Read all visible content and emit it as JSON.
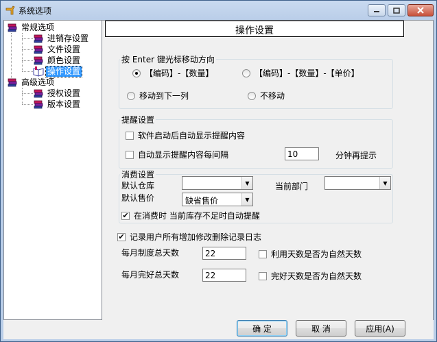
{
  "window": {
    "title": "系统选项"
  },
  "tree": {
    "groups": [
      {
        "label": "常规选项",
        "children": [
          "进销存设置",
          "文件设置",
          "颜色设置",
          "操作设置"
        ]
      },
      {
        "label": "高级选项",
        "children": [
          "授权设置",
          "版本设置"
        ]
      }
    ],
    "selected": "操作设置"
  },
  "panel": {
    "header": "操作设置",
    "enter_group": {
      "legend": "按 Enter 键光标移动方向",
      "options": [
        "【编码】-【数量】",
        "【编码】-【数量】-【单价】",
        "移动到下一列",
        "不移动"
      ],
      "selected_index": 0
    },
    "reminder_group": {
      "legend": "提醒设置",
      "show_on_start": "软件启动后自动显示提醒内容",
      "auto_show_interval": "自动显示提醒内容每间隔",
      "interval_value": "10",
      "interval_suffix": "分钟再提示"
    },
    "consume_group": {
      "legend": "消费设置",
      "default_warehouse_label": "默认仓库",
      "default_warehouse_value": "",
      "current_dept_label": "当前部门",
      "current_dept_value": "",
      "default_price_label": "默认售价",
      "default_price_value": "缺省售价",
      "stock_alert_label": "在消费时 当前库存不足时自动提醒",
      "stock_alert_checked": true
    },
    "log_changes": {
      "label": "记录用户所有增加修改删除记录日志",
      "checked": true
    },
    "monthly_days_label": "每月制度总天数",
    "monthly_days_value": "22",
    "use_natural_days_label": "利用天数是否为自然天数",
    "monthly_good_label": "每月完好总天数",
    "monthly_good_value": "22",
    "good_natural_days_label": "完好天数是否为自然天数"
  },
  "buttons": {
    "ok": "确 定",
    "cancel": "取 消",
    "apply": "应用(A)"
  }
}
